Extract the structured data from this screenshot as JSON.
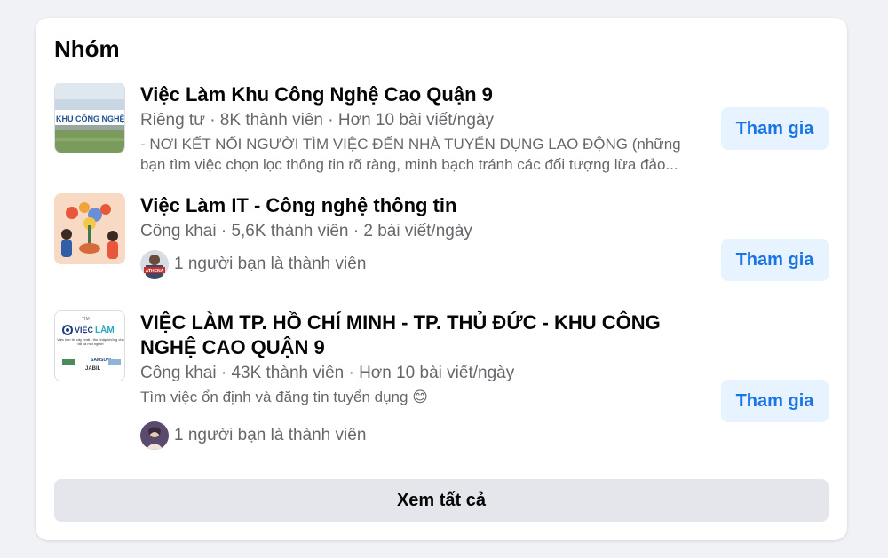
{
  "section": {
    "title": "Nhóm",
    "see_all_label": "Xem tất cả"
  },
  "groups": [
    {
      "name": "Việc Làm Khu Công Nghệ Cao Quận 9",
      "meta": "Riêng tư · 8K thành viên · Hơn 10 bài viết/ngày",
      "description": "- NƠI KẾT NỐI NGƯỜI TÌM VIỆC ĐẾN NHÀ TUYỂN DỤNG LAO ĐỘNG (những bạn tìm việc chọn lọc thông tin rõ ràng, minh bạch tránh các đối tượng lừa đảo...",
      "join_label": "Tham gia",
      "thumbnail_text": "KHU CÔNG NGHỆ CA"
    },
    {
      "name": "Việc Làm IT - Công nghệ thông tin",
      "meta": "Công khai · 5,6K thành viên · 2 bài viết/ngày",
      "friends_text": "1 người bạn là thành viên",
      "join_label": "Tham gia",
      "friend_avatar_text": "ATHENA"
    },
    {
      "name": "VIỆC LÀM TP. HỒ CHÍ MINH - TP. THỦ ĐỨC - KHU CÔNG NGHỆ CAO QUẬN 9",
      "meta": "Công khai · 43K thành viên · Hơn 10 bài viết/ngày",
      "description": "Tìm việc ổn định và đăng tin tuyển dụng 😊",
      "friends_text": "1 người bạn là thành viên",
      "join_label": "Tham gia",
      "thumbnail_small": "TÌM",
      "thumbnail_brand_a": "VIỆC",
      "thumbnail_brand_b": "LÀM",
      "thumbnail_tagline": "Việc làm tin cậy nhất - thu nhập khủng cho tất cả mọi người",
      "thumbnail_logos": [
        "SAMSUNG",
        "JABIL"
      ]
    }
  ],
  "colors": {
    "join_bg": "#e7f3ff",
    "join_text": "#1b74e4",
    "see_all_bg": "#e4e6eb"
  }
}
